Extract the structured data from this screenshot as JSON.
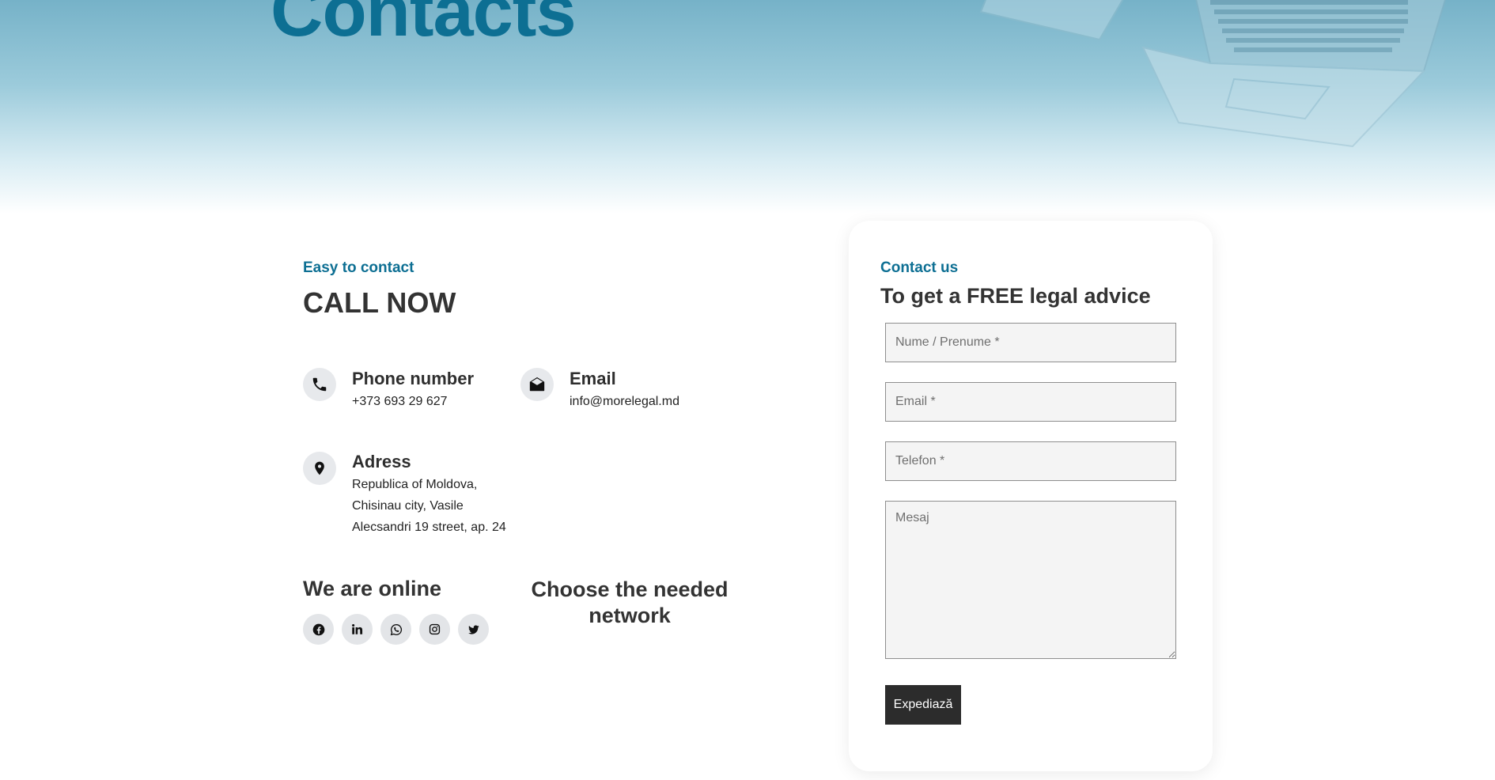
{
  "hero": {
    "title": "Contacts"
  },
  "contact_info": {
    "eyebrow": "Easy to contact",
    "heading": "CALL NOW",
    "phone": {
      "title": "Phone number",
      "value": "+373 693 29 627",
      "icon": "phone-icon"
    },
    "email": {
      "title": "Email",
      "value": "info@morelegal.md",
      "icon": "envelope-icon"
    },
    "address": {
      "title": "Adress",
      "lines": [
        "Republica of Moldova,",
        "Chisinau city, Vasile",
        "Alecsandri 19 street, ap. 24"
      ],
      "icon": "map-pin-icon"
    }
  },
  "online": {
    "heading": "We are online",
    "side_heading_line1": "Choose the needed",
    "side_heading_line2": "network",
    "networks": [
      "facebook-icon",
      "linkedin-icon",
      "whatsapp-icon",
      "instagram-icon",
      "twitter-icon"
    ]
  },
  "form": {
    "eyebrow": "Contact us",
    "heading": "To get a FREE legal advice",
    "name_placeholder": "Nume / Prenume *",
    "email_placeholder": "Email *",
    "phone_placeholder": "Telefon *",
    "message_placeholder": "Mesaj",
    "submit_label": "Expediază"
  },
  "colors": {
    "accent": "#0d6f93",
    "dark": "#2c2c2c",
    "icon_bg": "#e7e9ec"
  }
}
